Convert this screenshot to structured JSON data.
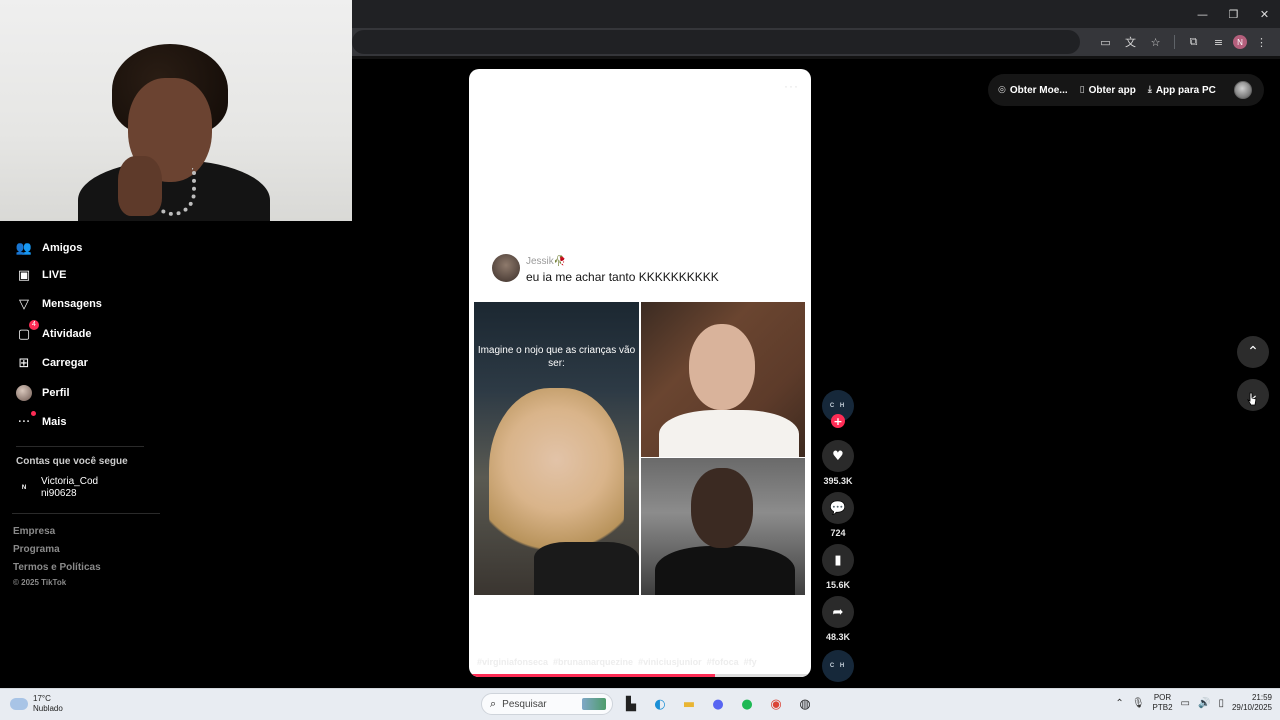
{
  "browser": {
    "window_controls": [
      "—",
      "❐",
      "✕"
    ],
    "profile_initial": "N",
    "toolbar_icons": [
      "cast-icon",
      "translate-icon",
      "star-icon",
      "extensions-icon",
      "media-control-icon",
      "profile-icon",
      "menu-icon"
    ]
  },
  "sidebar": {
    "items": [
      {
        "label": "Amigos",
        "icon": "friends-icon",
        "glyph": "👥"
      },
      {
        "label": "LIVE",
        "icon": "live-icon",
        "glyph": "▣"
      },
      {
        "label": "Mensagens",
        "icon": "messages-icon",
        "glyph": "▽"
      },
      {
        "label": "Atividade",
        "icon": "activity-icon",
        "glyph": "▢",
        "badge": "4"
      },
      {
        "label": "Carregar",
        "icon": "upload-icon",
        "glyph": "⊞"
      },
      {
        "label": "Perfil",
        "icon": "profile-icon"
      },
      {
        "label": "Mais",
        "icon": "more-icon",
        "glyph": "···"
      }
    ],
    "following_title": "Contas que você segue",
    "following": [
      {
        "name": "Victoria_Cod",
        "handle": "ni90628",
        "avatar_text": "N"
      }
    ],
    "footer_links": [
      "Empresa",
      "Programa",
      "Termos e Políticas"
    ],
    "copyright": "© 2025 TikTok"
  },
  "top_bar": {
    "buttons": [
      {
        "label": "Obter Moe...",
        "glyph": "◎"
      },
      {
        "label": "Obter app",
        "glyph": "▯"
      },
      {
        "label": "App para PC",
        "glyph": "⤓"
      }
    ]
  },
  "video": {
    "more_dots": "···",
    "comment_user": "Jessik🥀",
    "comment_text": "eu ia me achar tanto KKKKKKKKKK",
    "overlay_caption": "Imagine o nojo que as crianças vão ser:",
    "hashtags": [
      "#virginiafonseca",
      "#brunamarquezine",
      "#viniciusjunior",
      "#fofoca",
      "#fy"
    ],
    "progress": 0.72
  },
  "actions": {
    "creator_avatar_text": "C H",
    "follow_glyph": "+",
    "likes": "395.3K",
    "comments": "724",
    "saves": "15.6K",
    "shares": "48.3K",
    "music_avatar_text": "C H"
  },
  "feed_nav": {
    "up_glyph": "⌃",
    "down_glyph": "⌄"
  },
  "taskbar": {
    "weather_temp": "17°C",
    "weather_desc": "Nublado",
    "search_placeholder": "Pesquisar",
    "lang_top": "POR",
    "lang_bottom": "PTB2",
    "time": "21:59",
    "date": "29/10/2025"
  }
}
